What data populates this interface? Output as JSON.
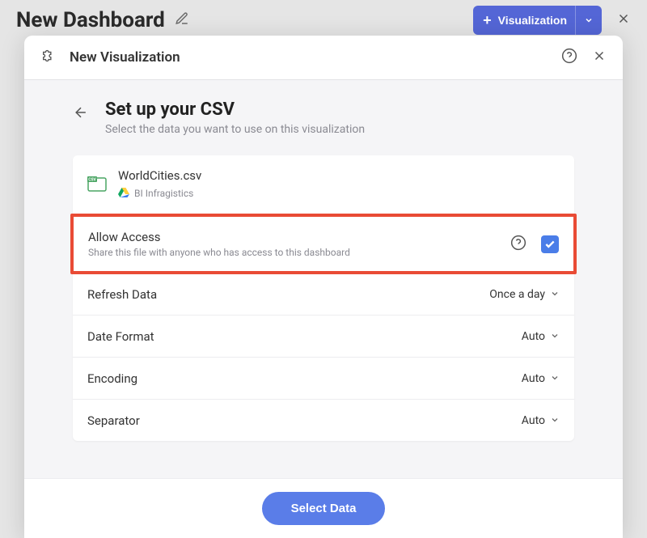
{
  "header": {
    "title": "New Dashboard",
    "viz_button_label": "Visualization"
  },
  "modal": {
    "title": "New Visualization",
    "setup_title": "Set up your CSV",
    "setup_subtitle": "Select the data you want to use on this visualization",
    "file": {
      "name": "WorldCities.csv",
      "source": "BI Infragistics"
    },
    "allow_access": {
      "label": "Allow Access",
      "sub": "Share this file with anyone who has access to this dashboard",
      "checked": true
    },
    "rows": {
      "refresh": {
        "label": "Refresh Data",
        "value": "Once a day"
      },
      "date_format": {
        "label": "Date Format",
        "value": "Auto"
      },
      "encoding": {
        "label": "Encoding",
        "value": "Auto"
      },
      "separator": {
        "label": "Separator",
        "value": "Auto"
      }
    },
    "footer_button": "Select Data"
  }
}
